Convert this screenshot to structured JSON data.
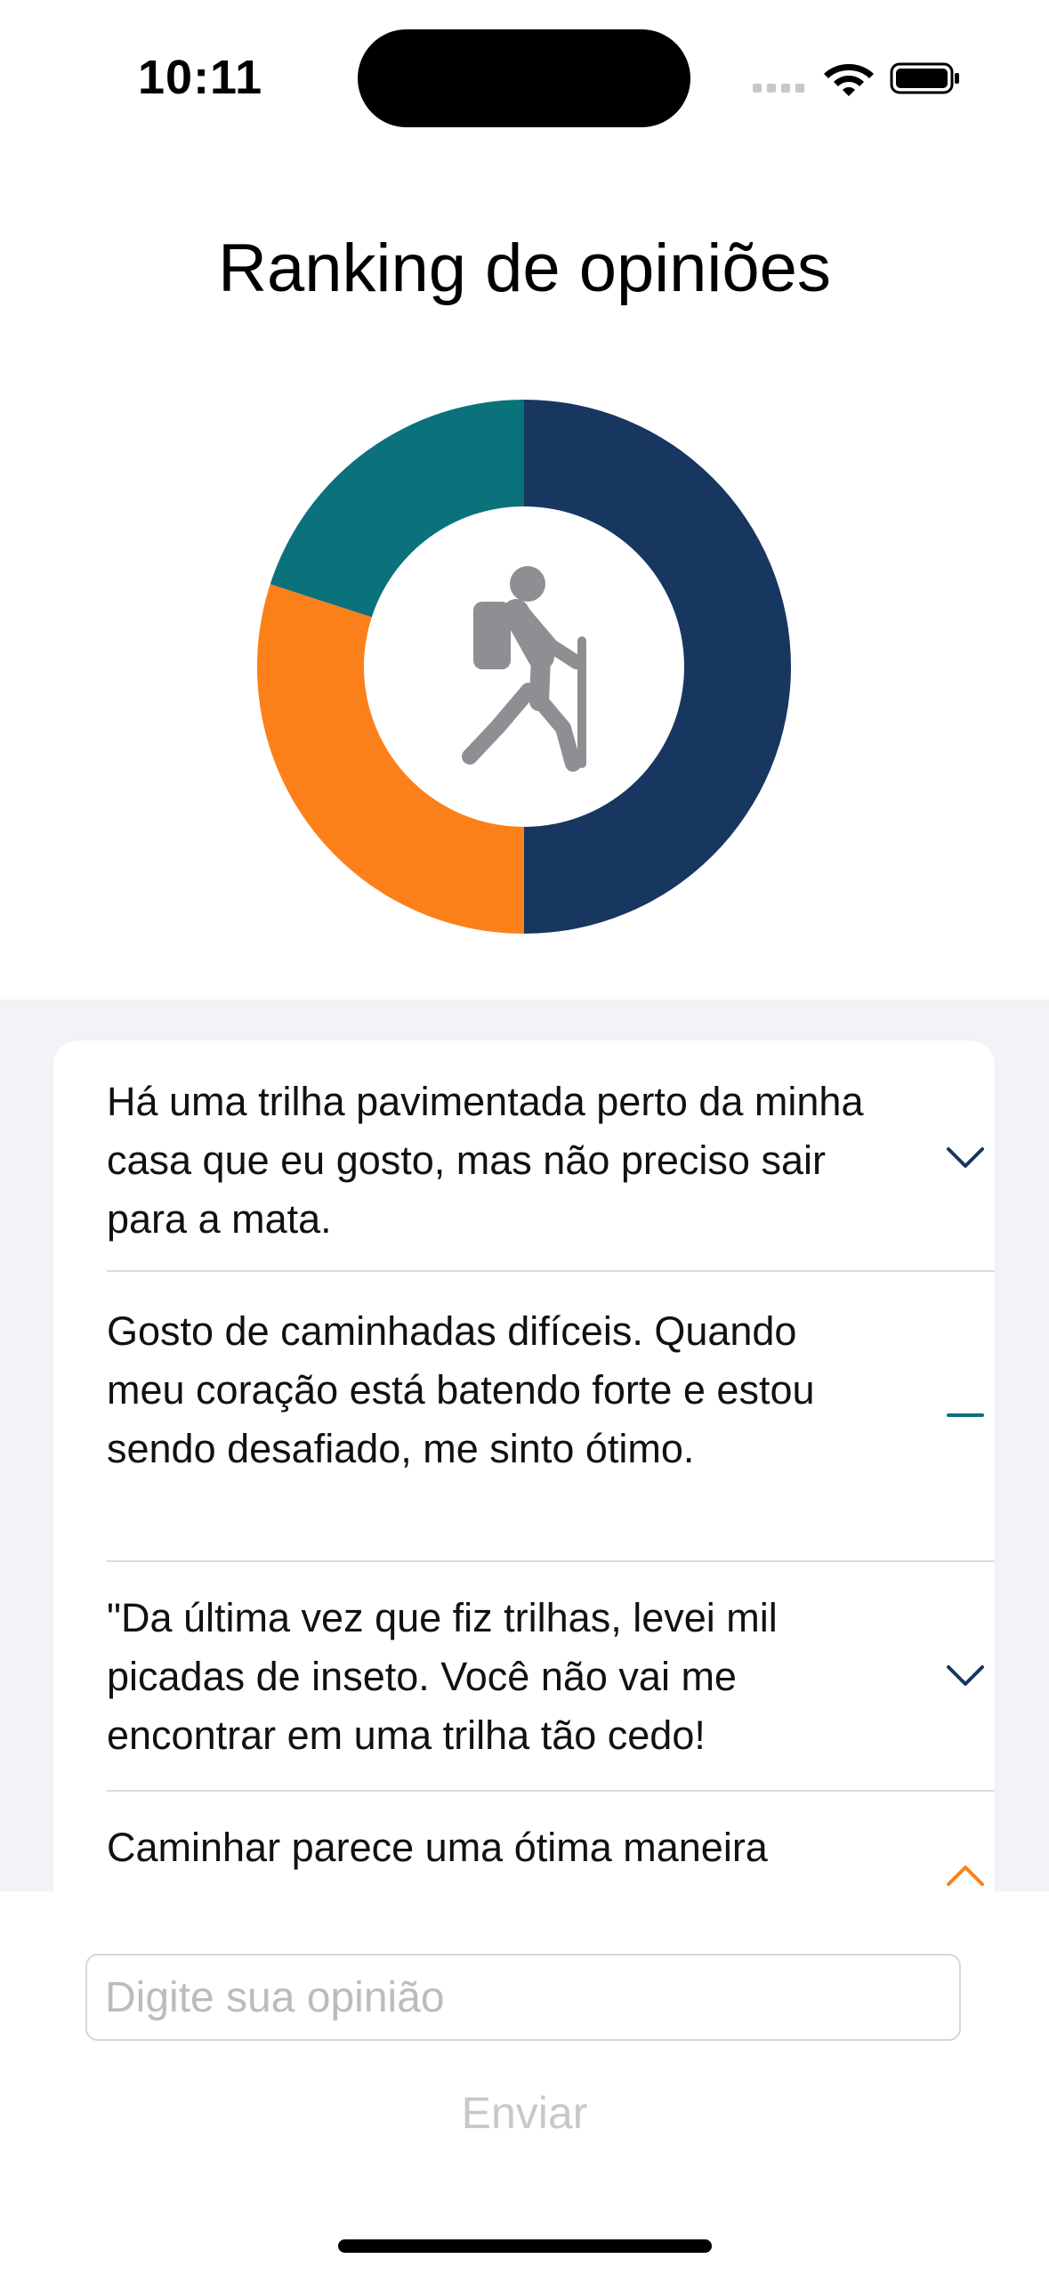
{
  "status_bar": {
    "time": "10:11"
  },
  "page_title": "Ranking de opiniões",
  "chart_data": {
    "type": "pie",
    "style": "donut",
    "center_icon": "hiking-person-icon",
    "slices": [
      {
        "fraction": 0.5,
        "color": "#173761"
      },
      {
        "fraction": 0.3,
        "color": "#fc8019"
      },
      {
        "fraction": 0.2,
        "color": "#0b727c"
      }
    ]
  },
  "opinions": [
    {
      "text": "Há uma trilha pavimentada perto da minha casa que eu gosto, mas não preciso sair para a mata.",
      "icon": "chevron-down-icon",
      "color": "#173761"
    },
    {
      "text": "Gosto de caminhadas difíceis. Quando meu coração está batendo forte e estou sendo desafiado, me sinto ótimo.",
      "icon": "dash-icon",
      "color": "#0b727c"
    },
    {
      "text": "\"Da última vez que fiz trilhas, levei mil picadas de inseto. Você não vai me encontrar em uma trilha tão cedo!",
      "icon": "chevron-down-icon",
      "color": "#173761"
    },
    {
      "text": "Caminhar parece uma ótima maneira",
      "icon": "chevron-up-icon",
      "color": "#fc8019"
    }
  ],
  "composer": {
    "placeholder": "Digite sua opinião",
    "value": "",
    "send_label": "Enviar"
  }
}
